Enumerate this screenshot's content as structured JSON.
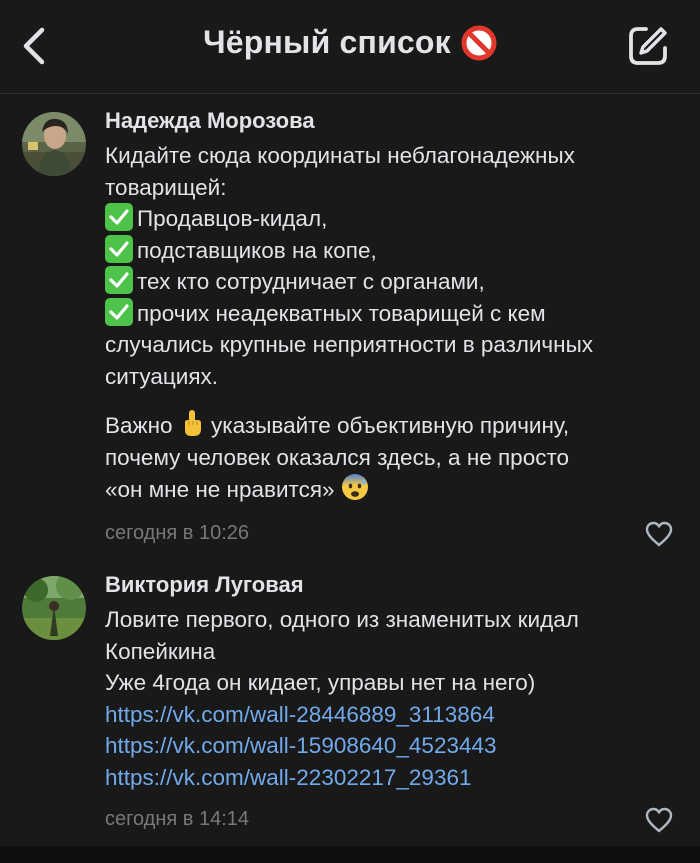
{
  "header": {
    "title": "Чёрный список",
    "back_icon": "chevron-left-icon",
    "title_emoji": "prohibited-icon",
    "edit_icon": "edit-icon"
  },
  "comments": [
    {
      "author": "Надежда Морозова",
      "text": {
        "line1": "Кидайте сюда координаты неблагонадежных",
        "line2": "товарищей:",
        "item1": "Продавцов-кидал,",
        "item2": "подставщиков на копе,",
        "item3": "тех кто сотрудничает с органами,",
        "item4": "прочих неадекватных товарищей с кем",
        "line7": "случались крупные неприятности в различных",
        "line8": "ситуациях.",
        "p2_line1_a": "Важно",
        "p2_line1_b": "указывайте объективную  причину,",
        "p2_line2": "почему человек оказался здесь, а не просто",
        "p2_line3": "«он мне не нравится»"
      },
      "time": "сегодня в 10:26"
    },
    {
      "author": "Виктория Луговая",
      "text": {
        "line1": "Ловите первого, одного из знаменитых кидал",
        "line2": "Копейкина",
        "line3": "Уже 4года он кидает, управы нет на него)"
      },
      "links": [
        "https://vk.com/wall-28446889_3113864",
        "https://vk.com/wall-15908640_4523443",
        "https://vk.com/wall-22302217_29361"
      ],
      "time": "сегодня в 14:14"
    }
  ],
  "colors": {
    "background": "#19191a",
    "text": "#e1e3e6",
    "secondary": "#76787a",
    "link": "#71aaeb",
    "check": "#4ec34a"
  }
}
